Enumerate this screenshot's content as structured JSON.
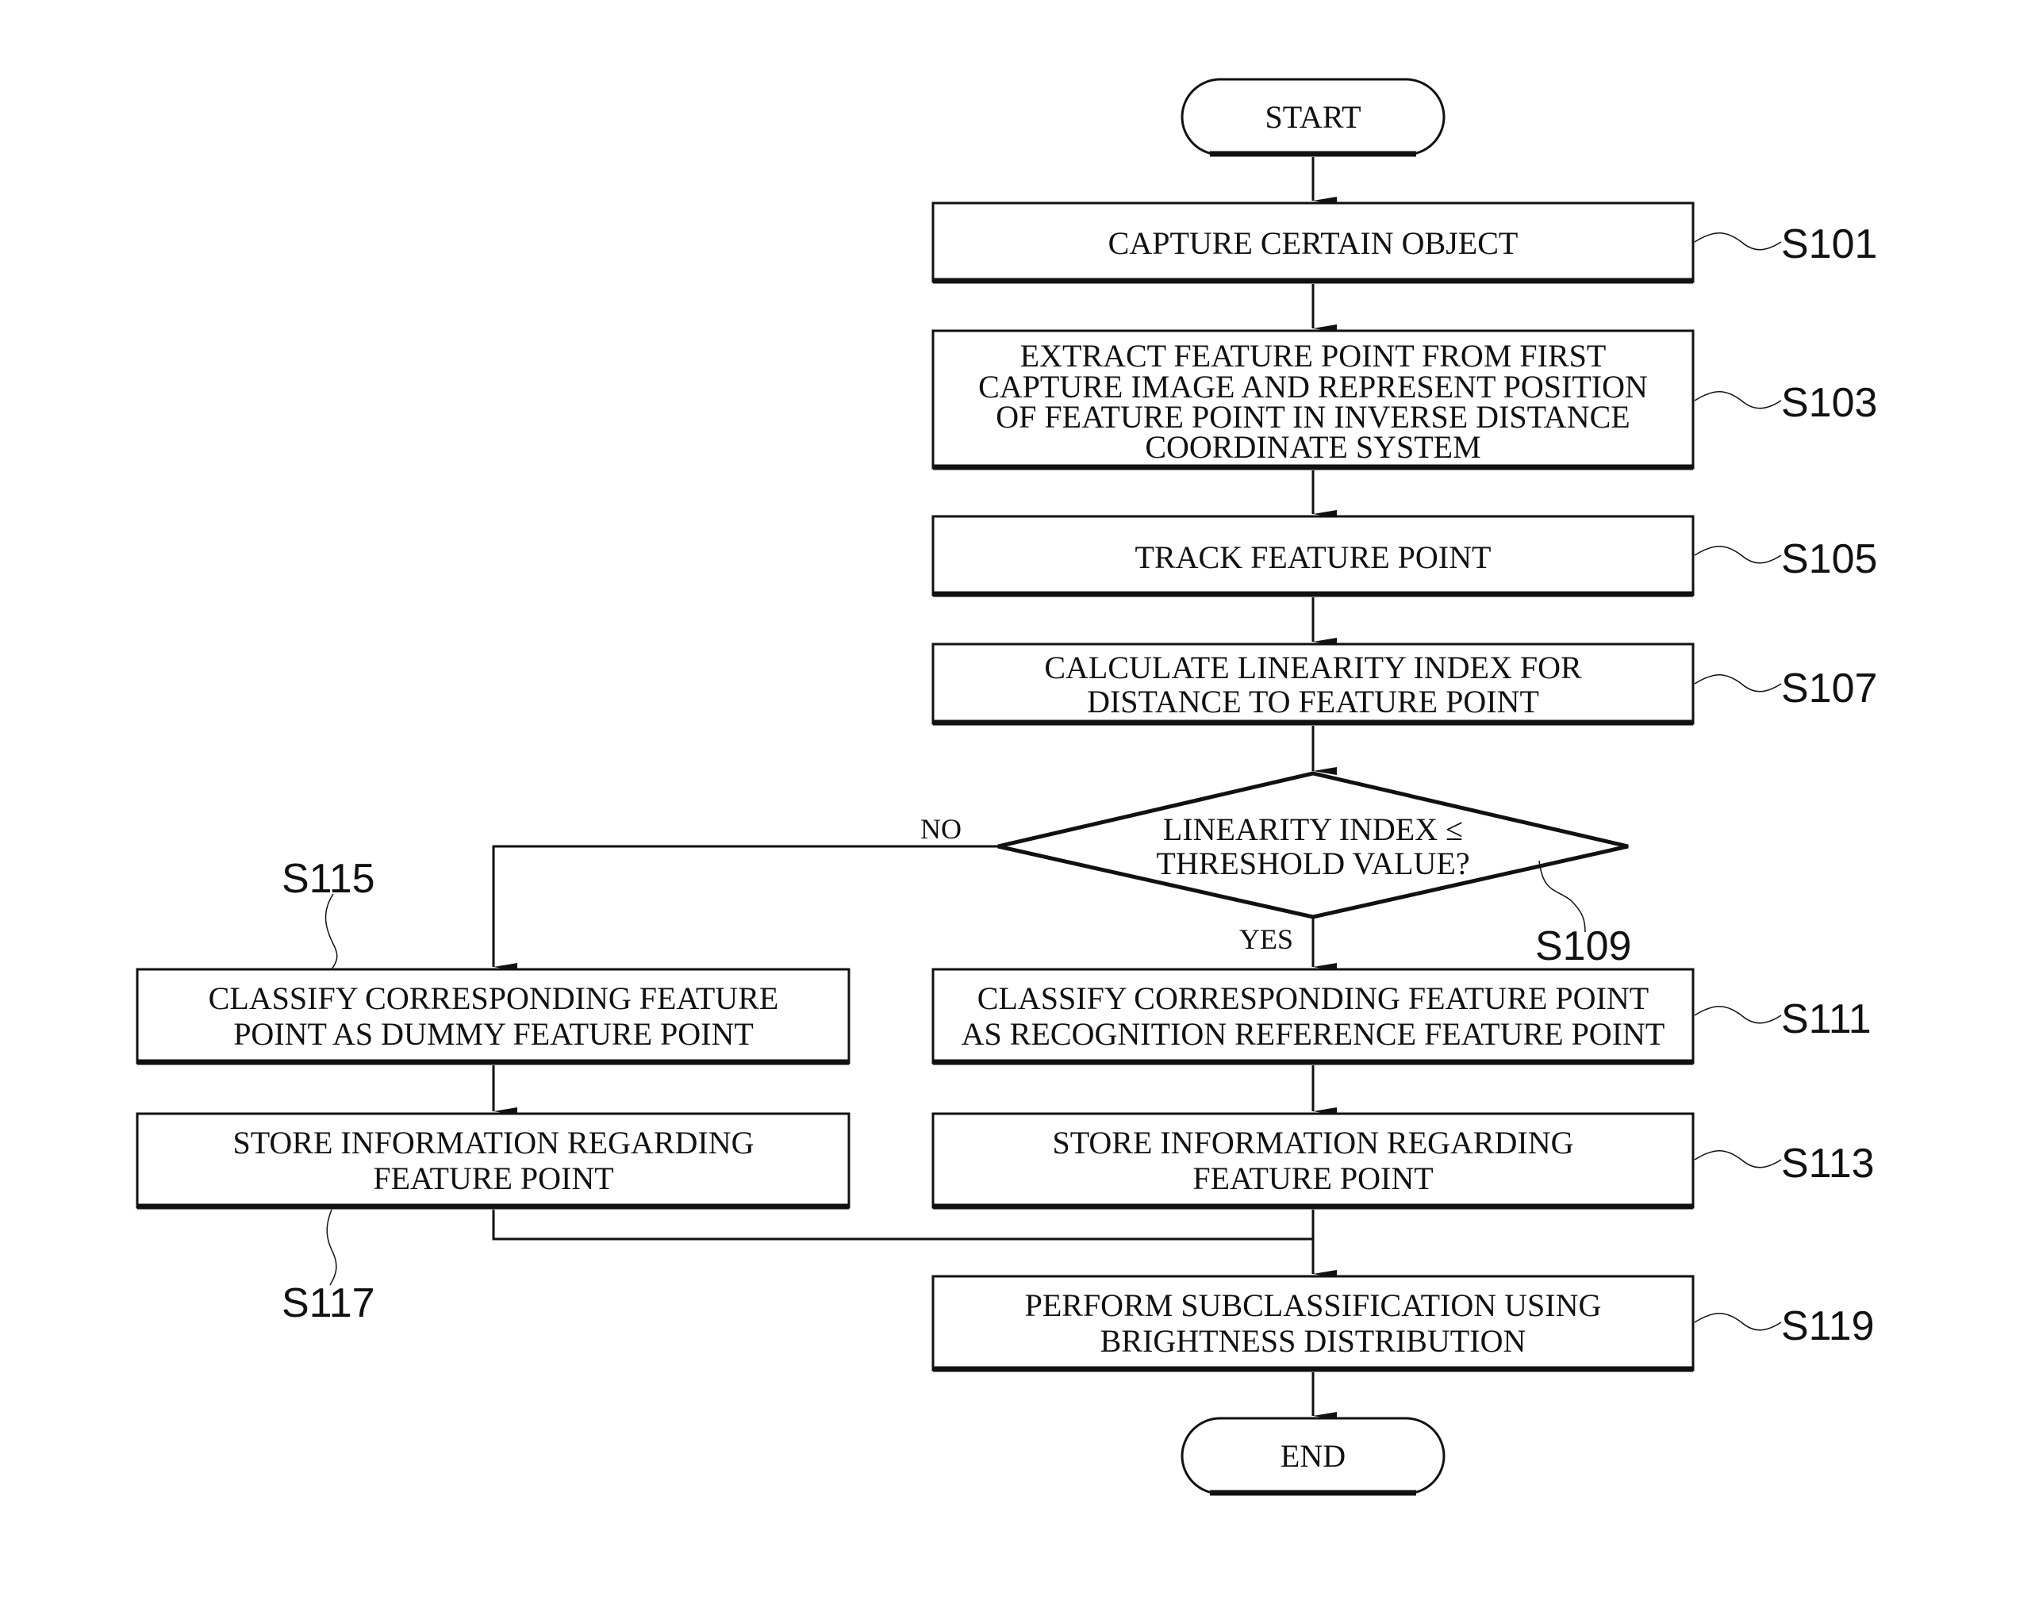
{
  "diagram": {
    "type": "flowchart",
    "start": {
      "label": "START"
    },
    "end": {
      "label": "END"
    },
    "steps": [
      {
        "id": "S101",
        "ref": "S101",
        "lines": [
          "CAPTURE CERTAIN OBJECT"
        ]
      },
      {
        "id": "S103",
        "ref": "S103",
        "lines": [
          "EXTRACT FEATURE POINT FROM FIRST",
          "CAPTURE IMAGE AND REPRESENT POSITION",
          "OF FEATURE POINT IN INVERSE DISTANCE",
          "COORDINATE SYSTEM"
        ]
      },
      {
        "id": "S105",
        "ref": "S105",
        "lines": [
          "TRACK FEATURE POINT"
        ]
      },
      {
        "id": "S107",
        "ref": "S107",
        "lines": [
          "CALCULATE LINEARITY INDEX FOR",
          "DISTANCE TO FEATURE POINT"
        ]
      },
      {
        "id": "S111",
        "ref": "S111",
        "lines": [
          "CLASSIFY CORRESPONDING FEATURE POINT",
          "AS RECOGNITION REFERENCE FEATURE POINT"
        ]
      },
      {
        "id": "S113",
        "ref": "S113",
        "lines": [
          "STORE INFORMATION REGARDING",
          "FEATURE POINT"
        ]
      },
      {
        "id": "S115",
        "ref": "S115",
        "lines": [
          "CLASSIFY CORRESPONDING FEATURE",
          "POINT AS DUMMY FEATURE POINT"
        ]
      },
      {
        "id": "S117",
        "ref": "S117",
        "lines": [
          "STORE INFORMATION REGARDING",
          "FEATURE POINT"
        ]
      },
      {
        "id": "S119",
        "ref": "S119",
        "lines": [
          "PERFORM SUBCLASSIFICATION USING",
          "BRIGHTNESS DISTRIBUTION"
        ]
      }
    ],
    "decision": {
      "id": "S109",
      "ref": "S109",
      "lines": [
        "LINEARITY INDEX ≤",
        "THRESHOLD VALUE?"
      ],
      "yes_label": "YES",
      "no_label": "NO"
    },
    "edges": [
      {
        "from": "START",
        "to": "S101"
      },
      {
        "from": "S101",
        "to": "S103"
      },
      {
        "from": "S103",
        "to": "S105"
      },
      {
        "from": "S105",
        "to": "S107"
      },
      {
        "from": "S107",
        "to": "S109"
      },
      {
        "from": "S109",
        "to": "S111",
        "label": "YES"
      },
      {
        "from": "S109",
        "to": "S115",
        "label": "NO"
      },
      {
        "from": "S111",
        "to": "S113"
      },
      {
        "from": "S115",
        "to": "S117"
      },
      {
        "from": "S113",
        "to": "S119"
      },
      {
        "from": "S117",
        "to": "S119"
      },
      {
        "from": "S119",
        "to": "END"
      }
    ]
  }
}
